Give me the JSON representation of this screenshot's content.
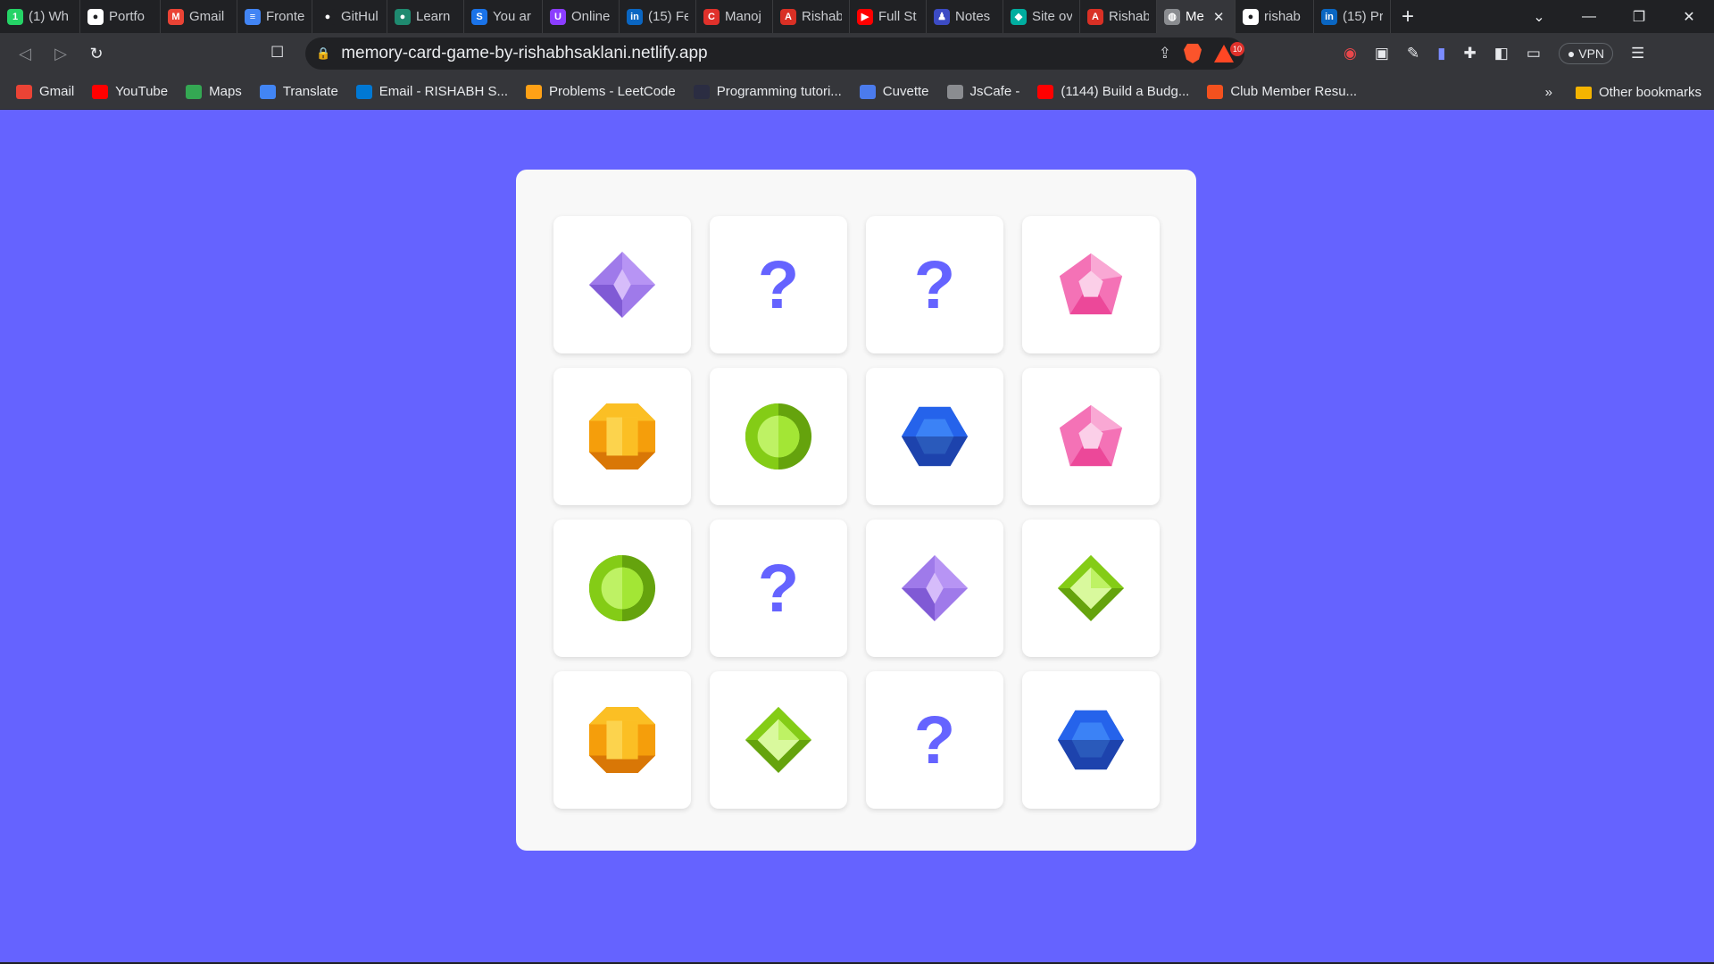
{
  "browser": {
    "tabs": [
      {
        "title": "(1) Wh",
        "icon": "whatsapp-icon",
        "color": "#25d366",
        "glyph": "1"
      },
      {
        "title": "Portfo",
        "icon": "github-icon",
        "color": "#ffffff",
        "glyph": "●"
      },
      {
        "title": "Gmail",
        "icon": "gmail-icon",
        "color": "#ea4335",
        "glyph": "M"
      },
      {
        "title": "Fronte",
        "icon": "docs-icon",
        "color": "#4285f4",
        "glyph": "≡"
      },
      {
        "title": "GitHul",
        "icon": "github-icon",
        "color": "#202124",
        "glyph": "●"
      },
      {
        "title": "Learn",
        "icon": "learn-icon",
        "color": "#1f8a70",
        "glyph": "●"
      },
      {
        "title": "You ar",
        "icon": "s-icon",
        "color": "#1a73e8",
        "glyph": "S"
      },
      {
        "title": "Online",
        "icon": "u-icon",
        "color": "#8b3dff",
        "glyph": "U"
      },
      {
        "title": "(15) Fe",
        "icon": "linkedin-icon",
        "color": "#0a66c2",
        "glyph": "in"
      },
      {
        "title": "Manoj",
        "icon": "c-icon",
        "color": "#e0312b",
        "glyph": "C"
      },
      {
        "title": "Rishab",
        "icon": "app-icon",
        "color": "#d93025",
        "glyph": "A"
      },
      {
        "title": "Full St",
        "icon": "youtube-icon",
        "color": "#ff0000",
        "glyph": "▶"
      },
      {
        "title": "Notes",
        "icon": "notes-icon",
        "color": "#3c4bc4",
        "glyph": "♟"
      },
      {
        "title": "Site ov",
        "icon": "netlify-icon",
        "color": "#00ad9f",
        "glyph": "◆"
      },
      {
        "title": "Rishab",
        "icon": "app-icon",
        "color": "#d93025",
        "glyph": "A"
      },
      {
        "title": "Me",
        "icon": "globe-icon",
        "color": "#8a8c90",
        "glyph": "◍",
        "active": true
      },
      {
        "title": "rishab",
        "icon": "github-icon",
        "color": "#ffffff",
        "glyph": "●"
      },
      {
        "title": "(15) Pr",
        "icon": "linkedin-icon",
        "color": "#0a66c2",
        "glyph": "in"
      }
    ],
    "url": "memory-card-game-by-rishabhsaklani.netlify.app",
    "bat_badge": "10",
    "vpn_label": "VPN",
    "bookmarks": [
      {
        "label": "Gmail",
        "icon": "gmail-icon",
        "color": "#ea4335"
      },
      {
        "label": "YouTube",
        "icon": "youtube-icon",
        "color": "#ff0000"
      },
      {
        "label": "Maps",
        "icon": "maps-icon",
        "color": "#34a853"
      },
      {
        "label": "Translate",
        "icon": "translate-icon",
        "color": "#4285f4"
      },
      {
        "label": "Email - RISHABH S...",
        "icon": "outlook-icon",
        "color": "#0078d4"
      },
      {
        "label": "Problems - LeetCode",
        "icon": "leetcode-icon",
        "color": "#ffa116"
      },
      {
        "label": "Programming tutori...",
        "icon": "tutorial-icon",
        "color": "#2b2d42"
      },
      {
        "label": "Cuvette",
        "icon": "cuvette-icon",
        "color": "#4b7bec"
      },
      {
        "label": "JsCafe -",
        "icon": "globe-icon",
        "color": "#8a8c90"
      },
      {
        "label": "(1144) Build a Budg...",
        "icon": "youtube-icon",
        "color": "#ff0000"
      },
      {
        "label": "Club Member Resu...",
        "icon": "chart-icon",
        "color": "#f4511e"
      }
    ],
    "overflow": "»",
    "other_bookmarks": "Other bookmarks"
  },
  "game": {
    "hidden_symbol": "?",
    "cards": [
      {
        "face": "gem-purple-diamond"
      },
      {
        "face": "hidden"
      },
      {
        "face": "hidden"
      },
      {
        "face": "gem-pink-pentagon"
      },
      {
        "face": "gem-orange-octagon"
      },
      {
        "face": "gem-green-round"
      },
      {
        "face": "gem-blue-hexagon"
      },
      {
        "face": "gem-pink-pentagon"
      },
      {
        "face": "gem-green-round"
      },
      {
        "face": "hidden"
      },
      {
        "face": "gem-purple-diamond"
      },
      {
        "face": "gem-green-rhombus"
      },
      {
        "face": "gem-orange-octagon"
      },
      {
        "face": "gem-green-rhombus"
      },
      {
        "face": "hidden"
      },
      {
        "face": "gem-blue-hexagon"
      }
    ]
  }
}
